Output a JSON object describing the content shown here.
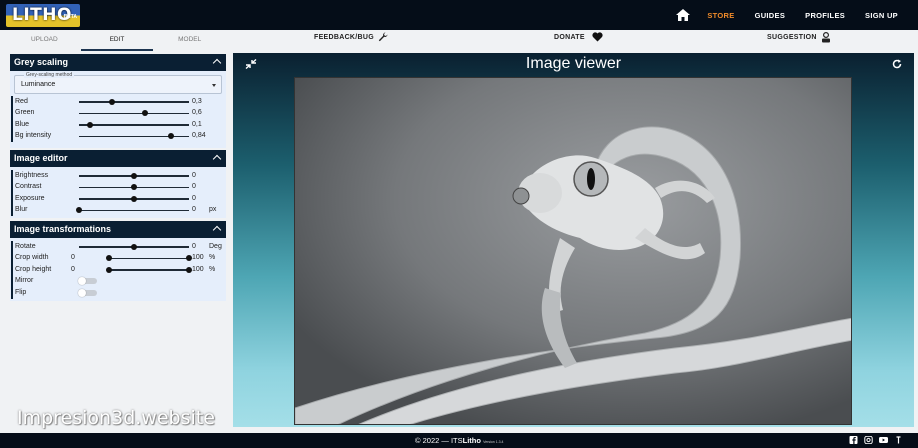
{
  "navbar": {
    "logo_text": "LITHO",
    "logo_badge": "BETA",
    "items": [
      {
        "label": "STORE",
        "active": true
      },
      {
        "label": "GUIDES",
        "active": false
      },
      {
        "label": "PROFILES",
        "active": false
      },
      {
        "label": "SIGN UP",
        "active": false
      }
    ]
  },
  "tabs": [
    "UPLOAD",
    "EDIT",
    "MODEL"
  ],
  "active_tab": "EDIT",
  "actions": {
    "feedback": "FEEDBACK/BUG",
    "donate": "DONATE",
    "suggestion": "SUGGESTION"
  },
  "grey_scaling": {
    "title": "Grey scaling",
    "method_label": "Grey-scaling method",
    "method_value": "Luminance",
    "sliders": [
      {
        "label": "Red",
        "value": "0,3",
        "fraction": 0.3
      },
      {
        "label": "Green",
        "value": "0,6",
        "fraction": 0.6
      },
      {
        "label": "Blue",
        "value": "0,1",
        "fraction": 0.1
      },
      {
        "label": "Bg intensity",
        "value": "0,84",
        "fraction": 0.84
      }
    ]
  },
  "image_editor": {
    "title": "Image editor",
    "sliders": [
      {
        "label": "Brightness",
        "value": "0",
        "fraction": 0.5,
        "unit": ""
      },
      {
        "label": "Contrast",
        "value": "0",
        "fraction": 0.5,
        "unit": ""
      },
      {
        "label": "Exposure",
        "value": "0",
        "fraction": 0.5,
        "unit": ""
      },
      {
        "label": "Blur",
        "value": "0",
        "fraction": 0.0,
        "unit": "px"
      }
    ]
  },
  "transformations": {
    "title": "Image transformations",
    "rotate": {
      "label": "Rotate",
      "value": "0",
      "fraction": 0.5,
      "unit": "Deg"
    },
    "crop_width": {
      "label": "Crop width",
      "min": "0",
      "max": "100",
      "unit": "%"
    },
    "crop_height": {
      "label": "Crop height",
      "min": "0",
      "max": "100",
      "unit": "%"
    },
    "mirror": {
      "label": "Mirror",
      "on": false
    },
    "flip": {
      "label": "Flip",
      "on": false
    }
  },
  "viewer": {
    "title": "Image viewer"
  },
  "watermark": "Impresion3d.website",
  "footer": {
    "copyright": "© 2022 — ITS",
    "brand": "Litho",
    "version": "Version 1.3.4"
  },
  "colors": {
    "navbar": "#050d18",
    "accent": "#f08b2a",
    "panel_header": "#0a1f33",
    "panel_bg": "#e5eefb"
  }
}
